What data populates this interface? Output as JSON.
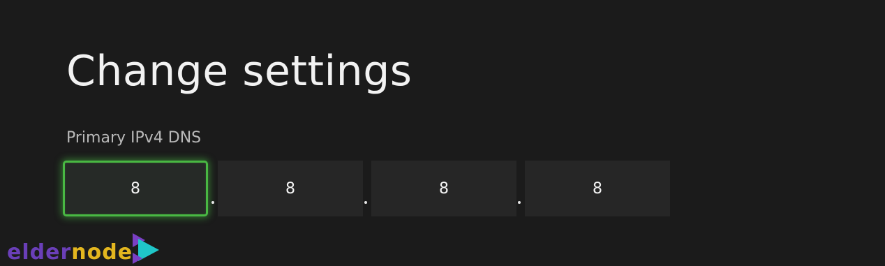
{
  "page": {
    "title": "Change settings"
  },
  "dns": {
    "label": "Primary IPv4 DNS",
    "octets": [
      "8",
      "8",
      "8",
      "8"
    ],
    "focused_octet": 0,
    "separator": "."
  },
  "watermark": {
    "text_part1": "elder",
    "text_part2": "node",
    "brand_colors": {
      "elder": "#6a3fb8",
      "node": "#e3b61f",
      "triangle_teal": "#1fc6c8",
      "triangle_purple": "#7a3fc4"
    }
  },
  "colors": {
    "background": "#1b1b1b",
    "field_background": "#262626",
    "focus_accent": "#49b843",
    "label_text": "#b9b9b9",
    "title_text": "#f2f2f2"
  }
}
